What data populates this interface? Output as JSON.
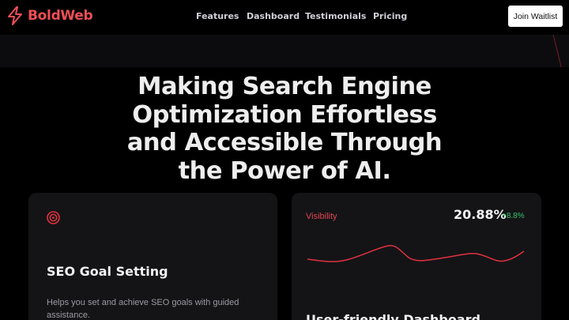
{
  "brand": {
    "name": "BoldWeb",
    "accent_color": "#ef4e57",
    "logo_icon": "lightning-bolt-icon"
  },
  "nav": {
    "links": [
      "Features",
      "Dashboard",
      "Testimonials",
      "Pricing"
    ],
    "cta_label": "Join Waitlist"
  },
  "hero": {
    "lines": [
      "Making Search Engine",
      "Optimization Effortless",
      "and Accessible Through",
      "the Power of AI."
    ]
  },
  "cards": {
    "goal": {
      "icon": "target-icon",
      "title": "SEO Goal Setting",
      "description": "Helps you set and achieve SEO goals with guided assistance."
    },
    "dashboard": {
      "metric_label": "Visibility",
      "metric_value": "20.88%",
      "metric_delta": "+8.8%",
      "delta_color": "#34c36a",
      "line_color": "#e0323e",
      "title": "User-friendly Dashboard"
    }
  }
}
